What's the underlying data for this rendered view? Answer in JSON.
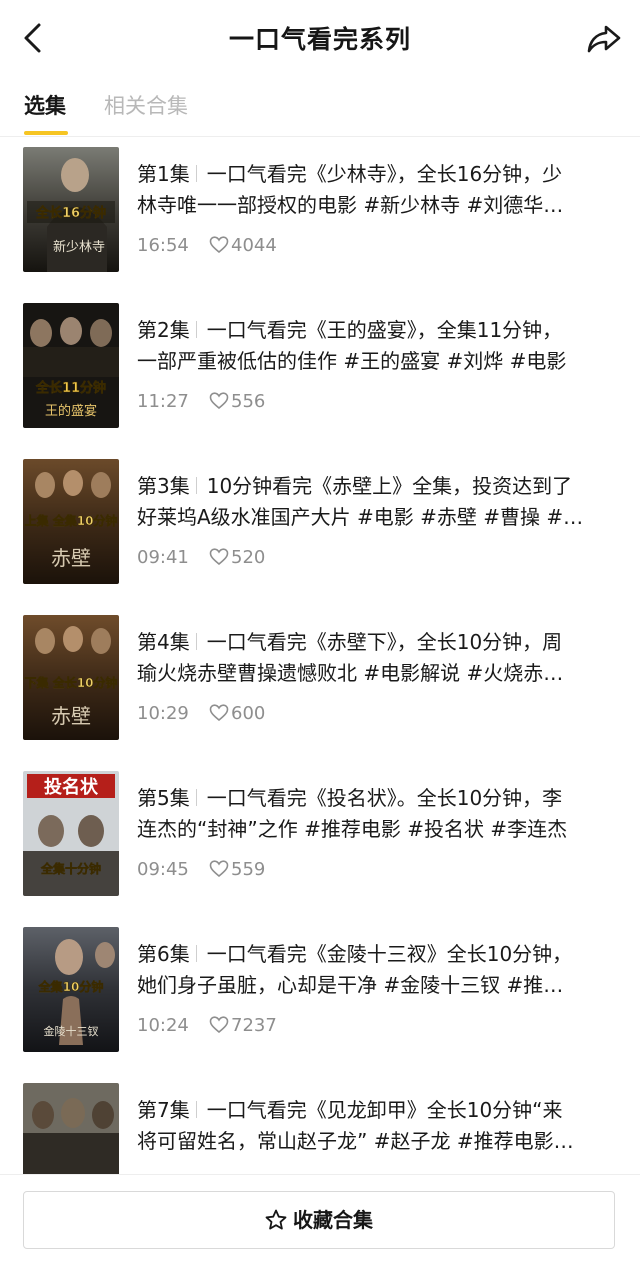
{
  "header": {
    "title": "一口气看完系列",
    "back_icon": "chevron-left-icon",
    "share_icon": "share-arrow-icon"
  },
  "tabs": [
    {
      "label": "选集",
      "active": true
    },
    {
      "label": "相关合集",
      "active": false
    }
  ],
  "accent_color": "#f6c523",
  "episodes": [
    {
      "ep": "第1集",
      "line1": "一口气看完《少林寺》，全长16分钟，少",
      "line2": "林寺唯一一部授权的电影 #新少林寺 #刘德华…",
      "duration": "16:54",
      "likes": "4044",
      "poster_text": "全长16分钟",
      "poster_sub": "新少林寺"
    },
    {
      "ep": "第2集",
      "line1": "一口气看完《王的盛宴》，全集11分钟，",
      "line2": "一部严重被低估的佳作 #王的盛宴 #刘烨 #电影",
      "duration": "11:27",
      "likes": "556",
      "poster_text": "全长11分钟",
      "poster_sub": "王的盛宴"
    },
    {
      "ep": "第3集",
      "line1": "10分钟看完《赤壁上》全集，投资达到了",
      "line2": "好莱坞A级水准国产大片 #电影 #赤壁 #曹操 #…",
      "duration": "09:41",
      "likes": "520",
      "poster_text": "上集 全集10分钟",
      "poster_sub": "赤壁"
    },
    {
      "ep": "第4集",
      "line1": "一口气看完《赤壁下》，全长10分钟，周",
      "line2": "瑜火烧赤壁曹操遗憾败北 #电影解说 #火烧赤…",
      "duration": "10:29",
      "likes": "600",
      "poster_text": "下集 全长10分钟",
      "poster_sub": "赤壁"
    },
    {
      "ep": "第5集",
      "line1": "一口气看完《投名状》。全长10分钟，李",
      "line2": "连杰的“封神”之作 #推荐电影 #投名状 #李连杰",
      "duration": "09:45",
      "likes": "559",
      "poster_text": "全集十分钟",
      "poster_sub": "投名状"
    },
    {
      "ep": "第6集",
      "line1": "一口气看完《金陵十三衩》全长10分钟，",
      "line2": "她们身子虽脏，心却是干净 #金陵十三钗 #推…",
      "duration": "10:24",
      "likes": "7237",
      "poster_text": "全集10分钟",
      "poster_sub": "金陵十三钗"
    },
    {
      "ep": "第7集",
      "line1": "一口气看完《见龙卸甲》全长10分钟“来",
      "line2": "将可留姓名，常山赵子龙” #赵子龙 #推荐电影…",
      "duration": "",
      "likes": "",
      "poster_text": "",
      "poster_sub": ""
    }
  ],
  "footer": {
    "collect_label": "收藏合集",
    "collect_icon": "star-outline-icon"
  }
}
